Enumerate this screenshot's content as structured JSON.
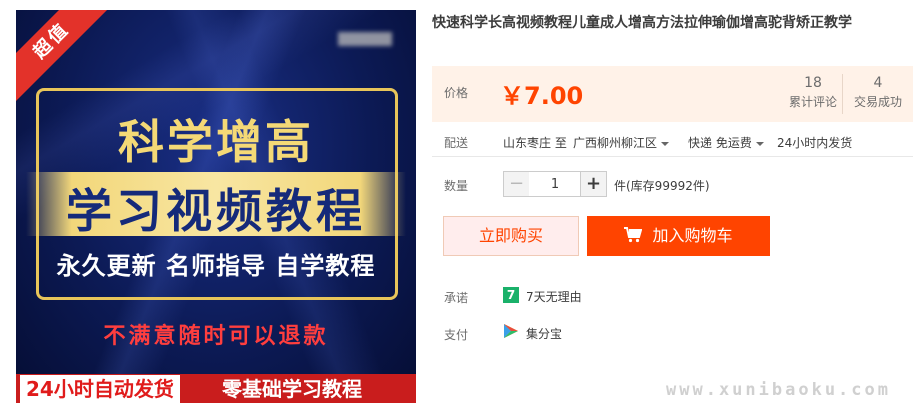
{
  "product_image": {
    "ribbon": "超值",
    "headline": "科学增高",
    "subheadline": "学习视频教程",
    "features": "永久更新 名师指导 自学教程",
    "refund": "不满意随时可以退款",
    "bottom_left": "24小时自动发货",
    "bottom_right": "零基础学习教程"
  },
  "product": {
    "title": "快速科学长高视频教程儿童成人增高方法拉伸瑜伽增高驼背矫正教学"
  },
  "price_box": {
    "label": "价格",
    "price": "￥7.00",
    "reviews_count": "18",
    "reviews_label": "累计评论",
    "sales_count": "4",
    "sales_label": "交易成功"
  },
  "shipping": {
    "label": "配送",
    "from": "山东枣庄 至",
    "to": "广西柳州柳江区",
    "method": "快递 免运费",
    "dispatch": "24小时内发货"
  },
  "quantity": {
    "label": "数量",
    "minus": "−",
    "value": "1",
    "plus": "+",
    "stock": "件(库存99992件)"
  },
  "actions": {
    "buy_now": "立即购买",
    "add_to_cart": "加入购物车"
  },
  "promise": {
    "label": "承诺",
    "badge": "7",
    "text": "7天无理由"
  },
  "payment": {
    "label": "支付",
    "text": "集分宝"
  },
  "watermark": "www.xunibaoku.com",
  "colors": {
    "price": "#ff4400",
    "cart_button": "#ff4400",
    "price_bg": "#fff2e8",
    "badge_green": "#1ab16a"
  },
  "icons": {
    "cart": "shopping-cart-icon",
    "promise": "seven-day-badge-icon",
    "payment": "jifenbao-icon"
  }
}
